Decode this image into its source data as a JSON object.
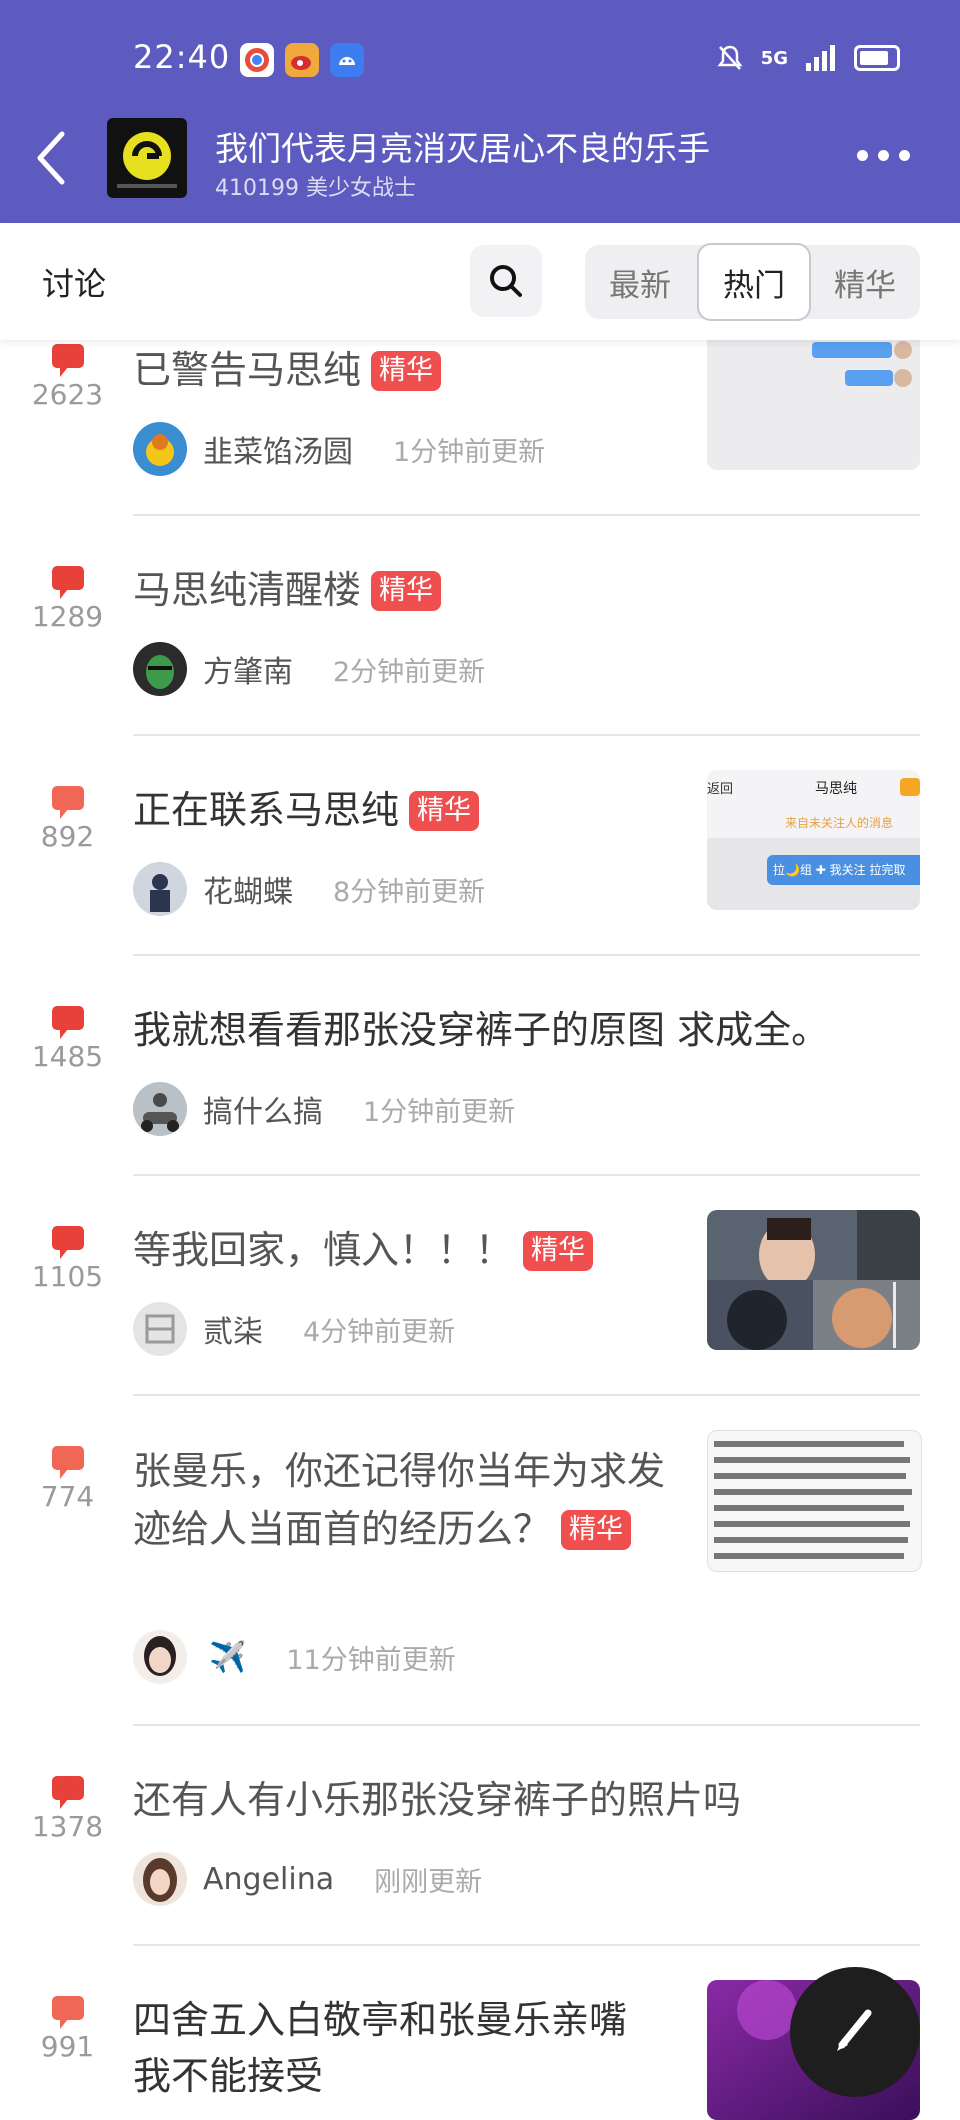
{
  "status_bar": {
    "time": "22:40",
    "signal_label": "5G",
    "app_icon_colors": [
      "#ffffff",
      "#f2a93b",
      "#3d7df0"
    ]
  },
  "header": {
    "title": "我们代表月亮消灭居心不良的乐手",
    "subtitle": "410199 美少女战士",
    "bg_color": "#5d5bbf"
  },
  "toolbar": {
    "section_title": "讨论",
    "sort_options": [
      "最新",
      "热门",
      "精华"
    ],
    "selected_sort": "热门"
  },
  "badge_label": "精华",
  "accent_color": "#ef4f4f",
  "posts": [
    {
      "count": "2623",
      "title": "已警告马思纯",
      "featured": true,
      "author": "韭菜馅汤圆",
      "time": "1分钟前更新"
    },
    {
      "count": "1289",
      "title": "马思纯清醒楼",
      "featured": true,
      "author": "方肇南",
      "time": "2分钟前更新"
    },
    {
      "count": "892",
      "title": "正在联系马思纯",
      "featured": true,
      "author": "花蝴蝶",
      "time": "8分钟前更新",
      "thumb_text": {
        "back": "返回",
        "name": "马思纯",
        "hint": "来自未关注人的消息",
        "action": "拉🌙组 ✚ 我关注 拉完取"
      }
    },
    {
      "count": "1485",
      "title": "我就想看看那张没穿裤子的原图 求成全。",
      "featured": false,
      "author": "搞什么搞",
      "time": "1分钟前更新"
    },
    {
      "count": "1105",
      "title": "等我回家，慎入！！！",
      "featured": true,
      "author": "贰柒",
      "time": "4分钟前更新"
    },
    {
      "count": "774",
      "title": "张曼乐，你还记得你当年为求发迹给人当面首的经历么？",
      "featured": true,
      "author": "✈️",
      "time": "11分钟前更新"
    },
    {
      "count": "1378",
      "title": "还有人有小乐那张没穿裤子的照片吗",
      "featured": false,
      "author": "Angelina",
      "time": "刚刚更新"
    },
    {
      "count": "991",
      "title": "四舍五入白敬亭和张曼乐亲嘴 我不能接受",
      "featured": false,
      "author": "",
      "time": ""
    }
  ]
}
